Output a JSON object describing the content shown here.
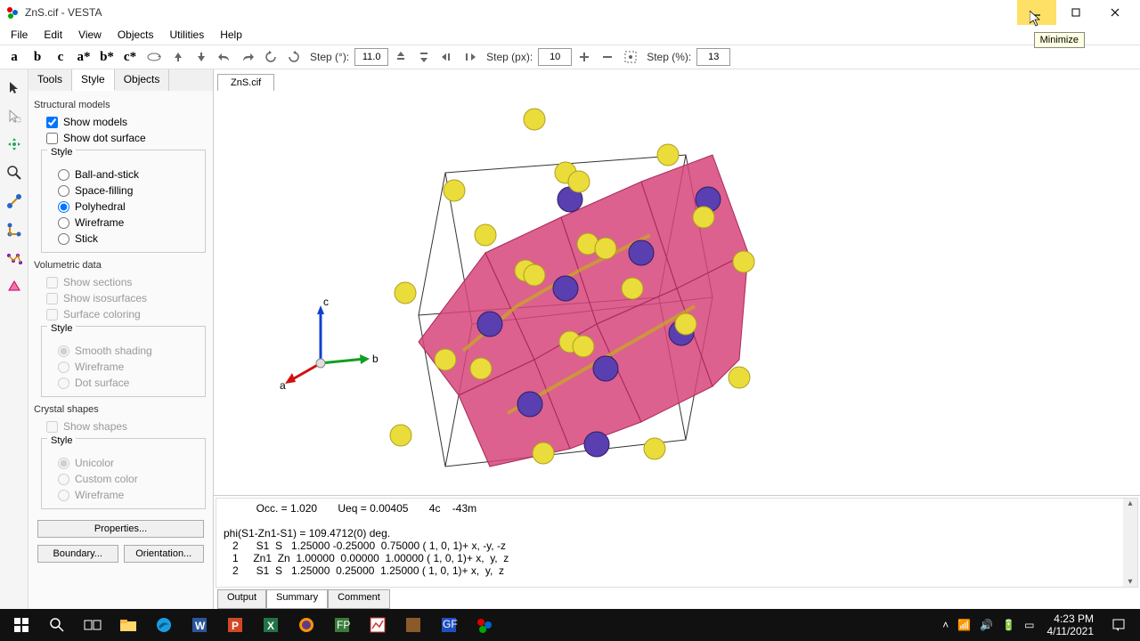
{
  "window": {
    "title": "ZnS.cif - VESTA",
    "tooltip": "Minimize"
  },
  "menu": {
    "file": "File",
    "edit": "Edit",
    "view": "View",
    "objects": "Objects",
    "utilities": "Utilities",
    "help": "Help"
  },
  "toolbar": {
    "a": "a",
    "b": "b",
    "c": "c",
    "astar": "a*",
    "bstar": "b*",
    "cstar": "c*",
    "step_deg_label": "Step (°):",
    "step_deg_val": "11.0",
    "step_px_label": "Step (px):",
    "step_px_val": "10",
    "step_pct_label": "Step (%):",
    "step_pct_val": "13"
  },
  "side_tabs": {
    "tools": "Tools",
    "style": "Style",
    "objects": "Objects"
  },
  "panel": {
    "structural": "Structural models",
    "show_models": "Show models",
    "show_dot": "Show dot surface",
    "style": "Style",
    "ball": "Ball-and-stick",
    "space": "Space-filling",
    "poly": "Polyhedral",
    "wire": "Wireframe",
    "stick": "Stick",
    "vol": "Volumetric data",
    "sections": "Show sections",
    "iso": "Show isosurfaces",
    "surfcol": "Surface coloring",
    "smooth": "Smooth shading",
    "wire2": "Wireframe",
    "dot2": "Dot surface",
    "crystal": "Crystal shapes",
    "shapes": "Show shapes",
    "unicolor": "Unicolor",
    "custcol": "Custom color",
    "wire3": "Wireframe",
    "props": "Properties...",
    "boundary": "Boundary...",
    "orientation": "Orientation..."
  },
  "viewer_tab": "ZnS.cif",
  "axes": {
    "a": "a",
    "b": "b",
    "c": "c"
  },
  "output": {
    "line0": "           Occ. = 1.020       Ueq = 0.00405       4c    -43m",
    "line1": "",
    "line2": "phi(S1-Zn1-S1) = 109.4712(0) deg.",
    "line3": "   2      S1  S   1.25000 -0.25000  0.75000 ( 1, 0, 1)+ x, -y, -z",
    "line4": "   1     Zn1  Zn  1.00000  0.00000  1.00000 ( 1, 0, 1)+ x,  y,  z",
    "line5": "   2      S1  S   1.25000  0.25000  1.25000 ( 1, 0, 1)+ x,  y,  z"
  },
  "out_tabs": {
    "output": "Output",
    "summary": "Summary",
    "comment": "Comment"
  },
  "taskbar": {
    "time": "4:23 PM",
    "date": "4/11/2021"
  }
}
